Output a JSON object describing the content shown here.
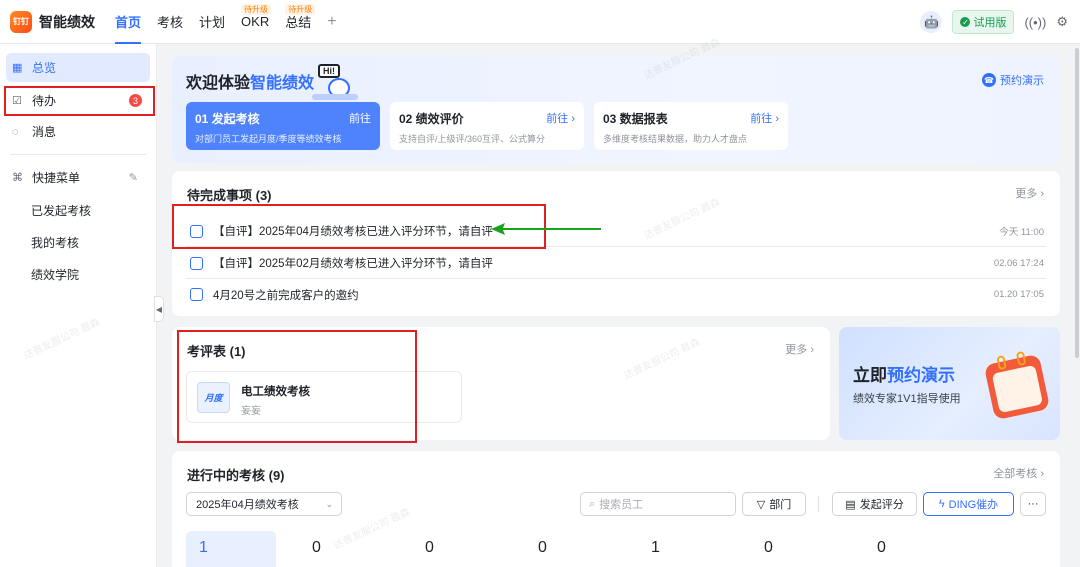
{
  "app": {
    "logo_text": "钉钉",
    "title": "智能绩效"
  },
  "nav": {
    "items": [
      {
        "label": "首页",
        "badge": ""
      },
      {
        "label": "考核",
        "badge": ""
      },
      {
        "label": "计划",
        "badge": ""
      },
      {
        "label": "OKR",
        "badge": "待升级"
      },
      {
        "label": "总结",
        "badge": "待升级"
      }
    ],
    "plus": "+"
  },
  "topright": {
    "trial_label": "试用版"
  },
  "sidebar": {
    "overview": "总览",
    "todo": "待办",
    "todo_count": "3",
    "messages": "消息",
    "quick_menu": "快捷菜单",
    "sub_items": [
      "已发起考核",
      "我的考核",
      "绩效学院"
    ]
  },
  "welcome": {
    "title_part1": "欢迎体验",
    "title_part2": "智能绩效",
    "mascot_text": "Hi!",
    "demo_link": "预约演示",
    "steps": [
      {
        "title": "01 发起考核",
        "go": "前往",
        "desc": "对部门员工发起月度/季度等绩效考核"
      },
      {
        "title": "02 绩效评价",
        "go": "前往 ›",
        "desc": "支持自评/上级评/360互评、公式算分"
      },
      {
        "title": "03 数据报表",
        "go": "前往 ›",
        "desc": "多维度考核结果数据，助力人才盘点"
      }
    ]
  },
  "pending": {
    "title": "待完成事项 (3)",
    "more": "更多 ›",
    "items": [
      {
        "text": "【自评】2025年04月绩效考核已进入评分环节，请自评",
        "time": "今天 11:00"
      },
      {
        "text": "【自评】2025年02月绩效考核已进入评分环节，请自评",
        "time": "02.06 17:24"
      },
      {
        "text": "4月20号之前完成客户的邀约",
        "time": "01.20 17:05"
      }
    ]
  },
  "review": {
    "title": "考评表 (1)",
    "more": "更多 ›",
    "item": {
      "icon_text": "月度",
      "name": "电工绩效考核",
      "sub": "妄妄"
    }
  },
  "promo": {
    "title_part1": "立即",
    "title_part2": "预约演示",
    "subtitle": "绩效专家1V1指导使用"
  },
  "ongoing": {
    "title": "进行中的考核 (9)",
    "all": "全部考核 ›",
    "select_value": "2025年04月绩效考核",
    "search_placeholder": "搜索员工",
    "dept_label": "部门",
    "start_eval_label": "发起评分",
    "ding_label": "DING催办",
    "more_btn": "···",
    "stats": [
      "1",
      "0",
      "0",
      "0",
      "1",
      "0",
      "0"
    ]
  },
  "watermark": "达普友服公司 聂森",
  "colors": {
    "accent": "#3370ff",
    "annotation": "#e02020",
    "arrow": "#1aa31a"
  }
}
